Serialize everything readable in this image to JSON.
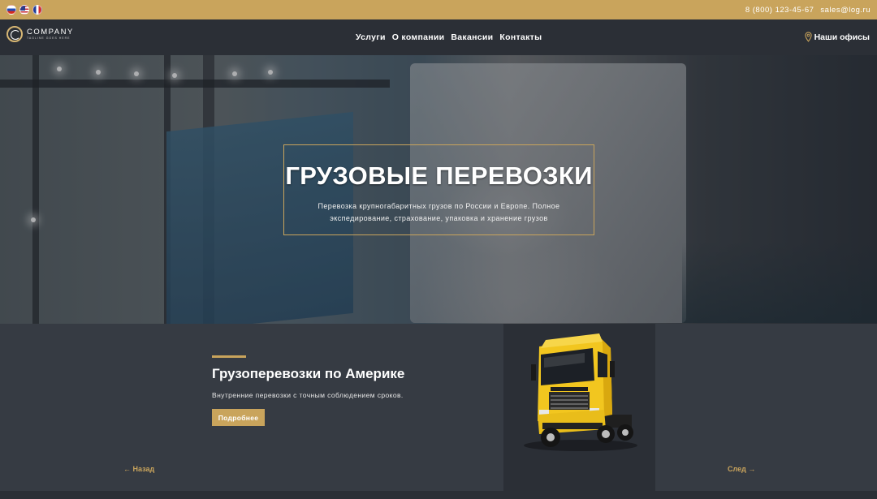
{
  "topbar": {
    "flags": [
      "flag-ru-icon",
      "flag-us-icon",
      "flag-fr-icon"
    ],
    "phone": "8 (800) 123-45-67",
    "email": "sales@log.ru"
  },
  "header": {
    "logo_name": "COMPANY",
    "logo_tagline": "TAGLINE GOES HERE",
    "menu": [
      "Услуги",
      "О компании",
      "Вакансии",
      "Контакты"
    ],
    "offices_label": "Наши офисы"
  },
  "hero": {
    "title": "ГРУЗОВЫЕ ПЕРЕВОЗКИ",
    "subtitle": "Перевозка крупногабаритных грузов по России и Европе. Полное экспедирование, страхование, упаковка и хранение грузов"
  },
  "slider": {
    "title": "Грузоперевозки по Америке",
    "text": "Внутренние перевозки с точным соблюдением сроков.",
    "button": "Подробнее",
    "prev": "← Назад",
    "next": "След →"
  },
  "colors": {
    "accent": "#c9a45c",
    "dark": "#2b2f36",
    "panel": "#363b43"
  }
}
